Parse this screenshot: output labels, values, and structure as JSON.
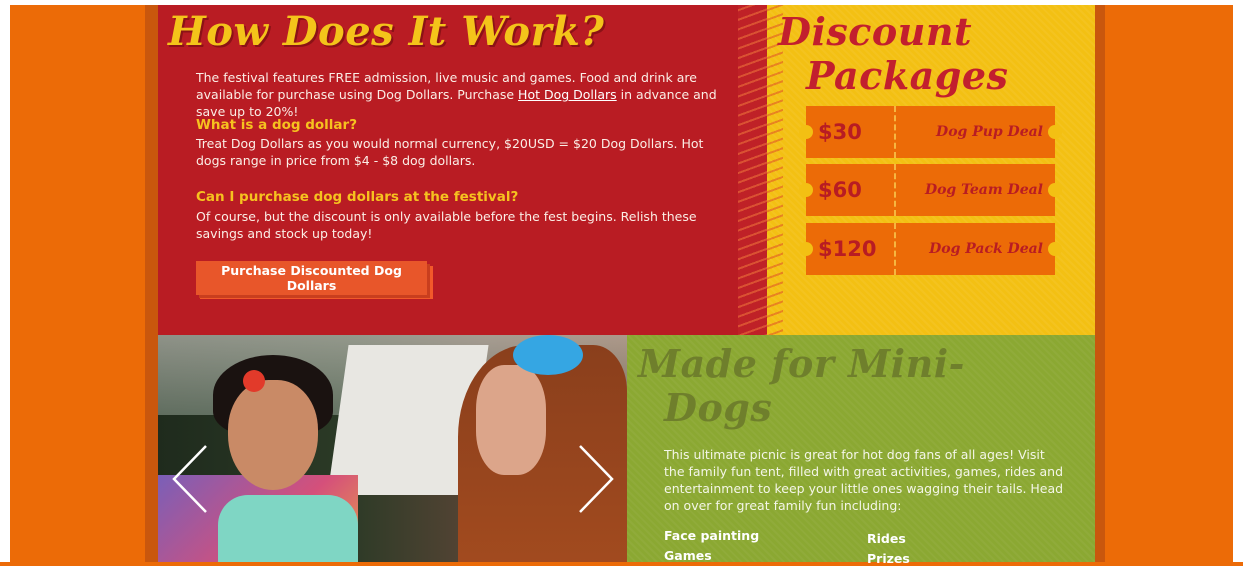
{
  "how_it_works": {
    "title": "How Does It Work?",
    "intro_before_link": "The festival features FREE admission, live music and games. Food and drink are available for purchase using Dog Dollars. Purchase ",
    "intro_link": "Hot Dog Dollars",
    "intro_after_link": " in advance and save up to 20%!",
    "faq": [
      {
        "question": "What is a dog dollar?",
        "answer": "Treat Dog Dollars as you would normal currency, $20USD = $20 Dog Dollars. Hot dogs range in price from $4 - $8 dog dollars."
      },
      {
        "question": "Can I purchase dog dollars at the festival?",
        "answer": "Of course, but the discount is only available before the fest begins. Relish these savings and stock up today!"
      }
    ],
    "cta_label": "Purchase Discounted Dog Dollars"
  },
  "discount_packages": {
    "title_line1": "Discount",
    "title_line2": "Packages",
    "tickets": [
      {
        "price": "$30",
        "deal": "Dog Pup Deal"
      },
      {
        "price": "$60",
        "deal": "Dog Team Deal"
      },
      {
        "price": "$120",
        "deal": "Dog Pack Deal"
      }
    ]
  },
  "mini_dogs": {
    "title_line1": "Made for Mini-",
    "title_line2": "Dogs",
    "intro": "This ultimate picnic is great for hot dog fans of all ages! Visit the family fun tent, filled with great activities, games, rides and entertainment to keep your little ones wagging their tails. Head on over for great family fun including:",
    "features_col1": [
      "Face painting",
      "Games"
    ],
    "features_col2": [
      "Rides",
      "Prizes"
    ]
  },
  "carousel": {
    "prev_icon": "chevron-left-icon",
    "next_icon": "chevron-right-icon"
  },
  "colors": {
    "background_orange": "#ec6b07",
    "red_panel": "#b91c23",
    "yellow_panel": "#f3c013",
    "green_panel": "#8ba832",
    "accent_yellow_text": "#f6c21f",
    "cta_orange": "#e8562a"
  }
}
